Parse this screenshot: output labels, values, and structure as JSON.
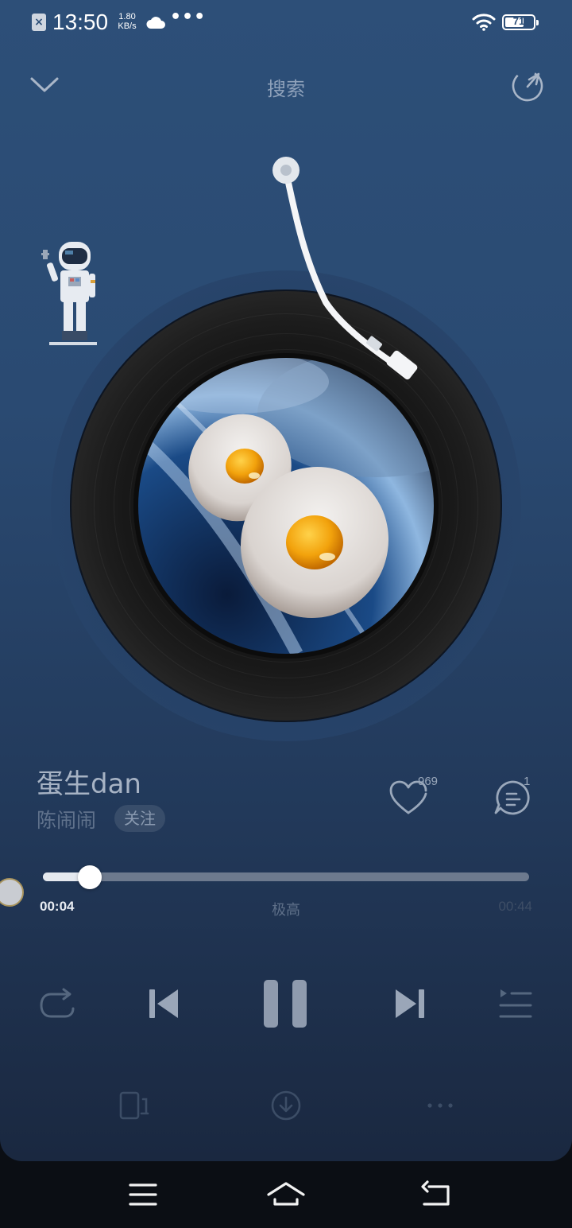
{
  "status_bar": {
    "time": "13:50",
    "speed_value": "1.80",
    "speed_unit": "KB/s",
    "dots": "•••",
    "battery_level": "71",
    "battery_fraction": 0.71
  },
  "header": {
    "title": "搜索"
  },
  "song": {
    "title": "蛋生dan",
    "artist": "陈闹闹",
    "follow_label": "关注",
    "like_count": "969",
    "comment_count": "1"
  },
  "progress": {
    "current": "00:04",
    "total": "00:44",
    "quality": "极高",
    "fraction": 0.097
  },
  "icons": {
    "collapse": "chevron-down-icon",
    "share": "share-icon",
    "like": "heart-icon",
    "comment": "comment-icon",
    "repeat": "repeat-icon",
    "prev": "skip-previous-icon",
    "pause": "pause-icon",
    "next": "skip-next-icon",
    "playlist": "playlist-icon",
    "device": "device-icon",
    "download": "download-icon",
    "more": "more-icon",
    "nav_menu": "menu-icon",
    "nav_home": "home-icon",
    "nav_back": "back-icon"
  },
  "colors": {
    "background_top": "#2d4f78",
    "background_bottom": "#1a2840",
    "accent": "#e5e9ef"
  }
}
